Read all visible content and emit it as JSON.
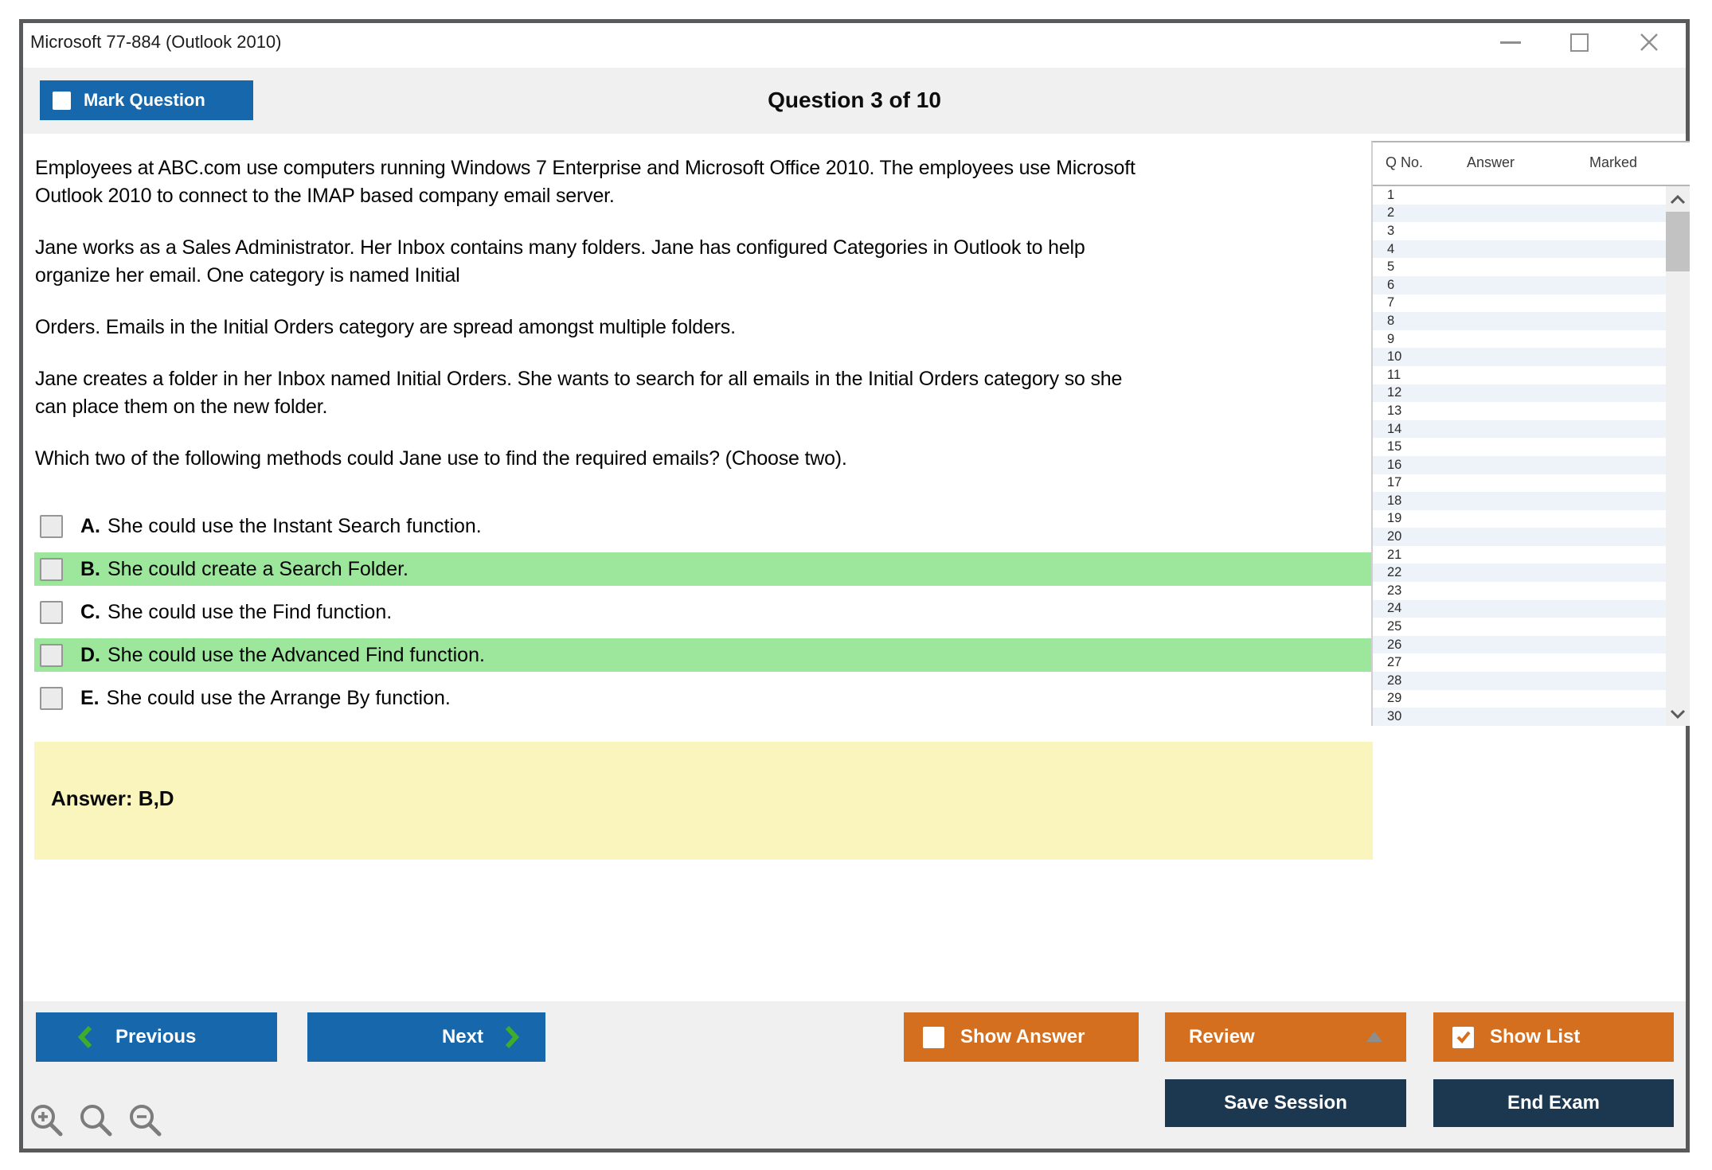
{
  "window": {
    "title": "Microsoft 77-884 (Outlook 2010)"
  },
  "header": {
    "mark_question_label": "Mark Question",
    "title": "Question 3 of 10"
  },
  "question": {
    "paragraphs": [
      {
        "lines": [
          "Employees at ABC.com use computers running Windows 7 Enterprise and Microsoft Office 2010. The employees use Microsoft",
          "Outlook 2010 to connect to the IMAP based company email server."
        ]
      },
      {
        "lines": [
          "Jane works as a Sales Administrator. Her Inbox contains many folders. Jane has configured Categories in Outlook to help",
          "organize her email. One category is named Initial"
        ]
      },
      {
        "lines": [
          "Orders. Emails in the Initial Orders category are spread amongst multiple folders."
        ]
      },
      {
        "lines": [
          "Jane creates a folder in her Inbox named Initial Orders. She wants to search for all emails in the Initial Orders category so she",
          "can place them on the new folder."
        ]
      },
      {
        "lines": [
          "Which two of the following methods could Jane use to find the required emails? (Choose two)."
        ]
      }
    ],
    "options": [
      {
        "letter": "A.",
        "text": "She could use the Instant Search function.",
        "highlighted": false
      },
      {
        "letter": "B.",
        "text": "She could create a Search Folder.",
        "highlighted": true
      },
      {
        "letter": "C.",
        "text": "She could use the Find function.",
        "highlighted": false
      },
      {
        "letter": "D.",
        "text": "She could use the Advanced Find function.",
        "highlighted": true
      },
      {
        "letter": "E.",
        "text": "She could use the Arrange By function.",
        "highlighted": false
      }
    ],
    "answer_label": "Answer: B,D"
  },
  "question_list": {
    "columns": [
      "Q No.",
      "Answer",
      "Marked"
    ],
    "rows": [
      "1",
      "2",
      "3",
      "4",
      "5",
      "6",
      "7",
      "8",
      "9",
      "10",
      "11",
      "12",
      "13",
      "14",
      "15",
      "16",
      "17",
      "18",
      "19",
      "20",
      "21",
      "22",
      "23",
      "24",
      "25",
      "26",
      "27",
      "28",
      "29",
      "30"
    ]
  },
  "navigation": {
    "previous_label": "Previous",
    "next_label": "Next"
  },
  "actions": {
    "show_answer_label": "Show Answer",
    "review_label": "Review",
    "show_list_label": "Show List",
    "save_session_label": "Save Session",
    "end_exam_label": "End Exam"
  },
  "icons": {
    "minimize": "–",
    "maximize": "□",
    "close": "✕",
    "previous_chevron": "❮",
    "next_chevron": "❯",
    "review_arrow_up": "▲",
    "scroll_up": "⌃",
    "scroll_down": "⌄",
    "zoom_in": "⊕",
    "zoom_lens": "🔍",
    "zoom_out": "⊖",
    "show_list_check": "✓"
  },
  "colors": {
    "accent_blue": "#1767ad",
    "accent_orange": "#d46f1f",
    "accent_navy": "#1c3850",
    "highlight_green": "#9ce79c",
    "answer_yellow": "#faf5bd",
    "chevron_green": "#3fad2b",
    "row_stripe_blue": "#edf3f9",
    "chrome_gray": "#f0f0f0"
  }
}
